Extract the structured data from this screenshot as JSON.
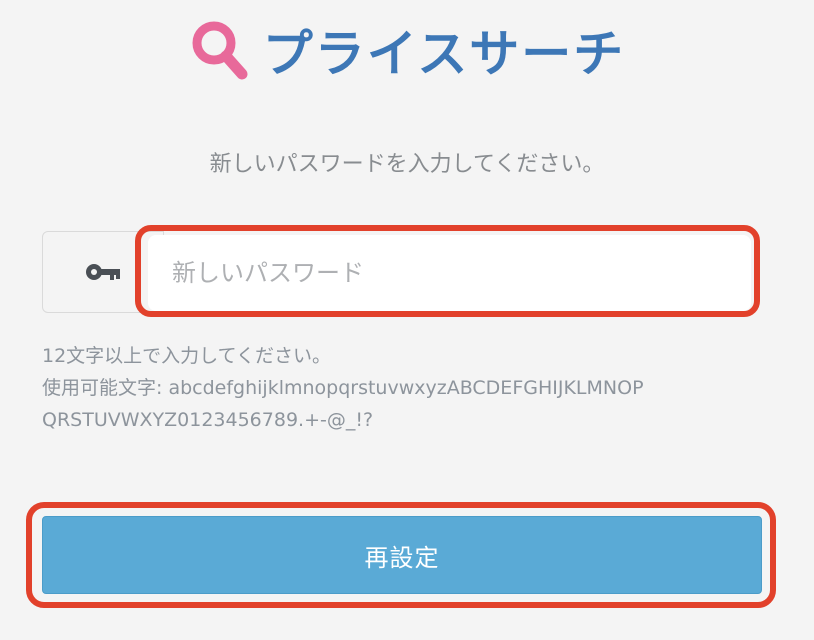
{
  "logo": {
    "text": "プライスサーチ",
    "icon": "search-magnifier-icon",
    "icon_color": "#e8699a",
    "text_color": "#3d77b6"
  },
  "instruction": "新しいパスワードを入力してください。",
  "password_field": {
    "icon": "key-icon",
    "placeholder": "新しいパスワード",
    "value": ""
  },
  "hint": {
    "length_rule": "12文字以上で入力してください。",
    "allowed_chars_line1": "使用可能文字: abcdefghijklmnopqrstuvwxyzABCDEFGHIJKLMNOP",
    "allowed_chars_line2": "QRSTUVWXYZ0123456789.+-@_!?"
  },
  "submit_button": {
    "label": "再設定",
    "color": "#5aaad6"
  },
  "highlight_color": "#e2412b"
}
